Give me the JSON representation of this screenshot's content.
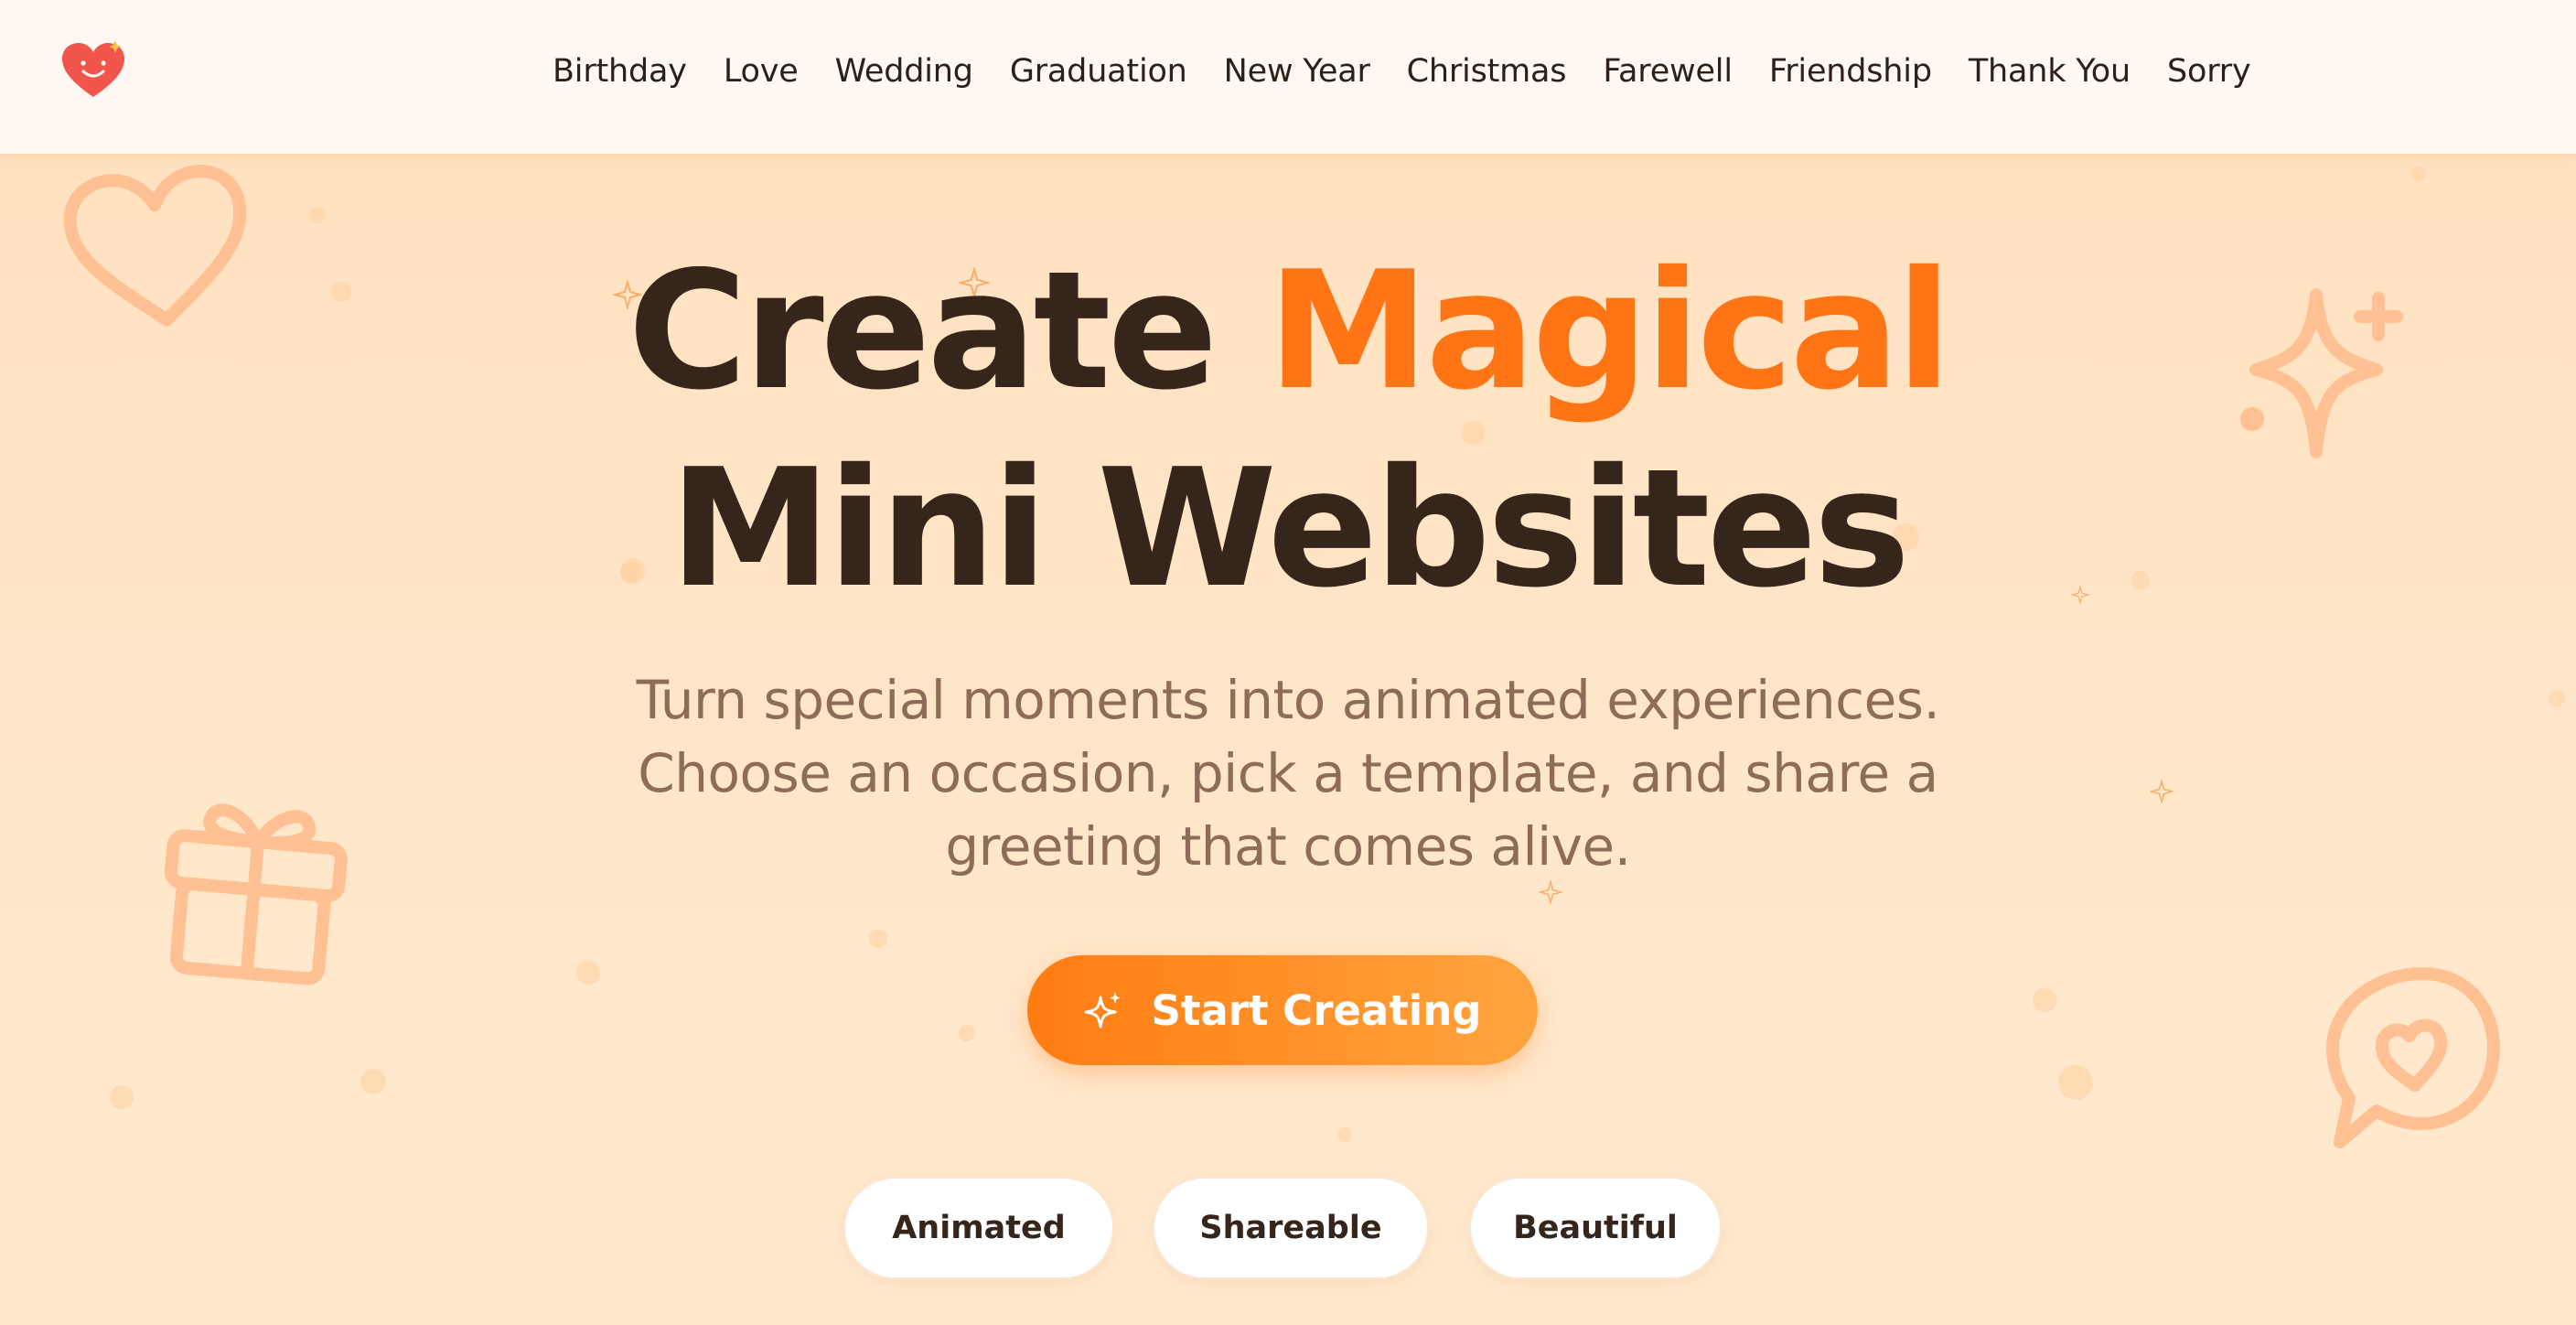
{
  "nav": {
    "logo_icon": "smiling-heart-icon",
    "links": [
      {
        "label": "Birthday"
      },
      {
        "label": "Love"
      },
      {
        "label": "Wedding"
      },
      {
        "label": "Graduation"
      },
      {
        "label": "New Year"
      },
      {
        "label": "Christmas"
      },
      {
        "label": "Farewell"
      },
      {
        "label": "Friendship"
      },
      {
        "label": "Thank You"
      },
      {
        "label": "Sorry"
      }
    ]
  },
  "hero": {
    "title_line1_prefix": "Create",
    "title_line1_accent": "Magical",
    "title_line2": "Mini Websites",
    "subtitle_lines": [
      "Turn special moments into animated experiences.",
      "Choose an occasion, pick a template, and share a",
      "greeting that comes alive."
    ]
  },
  "cta": {
    "label": "Start Creating",
    "icon": "sparkle-icon"
  },
  "features": [
    {
      "label": "Animated"
    },
    {
      "label": "Shareable"
    },
    {
      "label": "Beautiful"
    }
  ],
  "decor_icons": [
    "heart-outline-icon",
    "gift-icon",
    "sparkle-star-icon",
    "chat-heart-icon"
  ],
  "colors": {
    "accent": "#ff7516",
    "heading": "#35251a",
    "subtitle": "#8e6c58",
    "background": "#ffe4c4",
    "nav_background": "#fff8f3",
    "cta_gradient_start": "#ff7c12",
    "cta_gradient_end": "#ffa53e"
  }
}
